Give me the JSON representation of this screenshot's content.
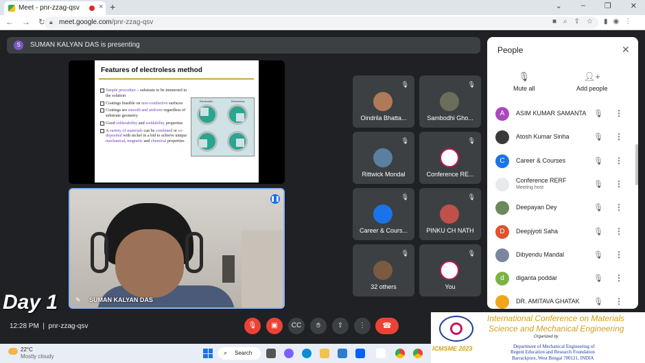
{
  "browser": {
    "tab_title": "Meet - pnr-zzag-qsv",
    "tab_close": "×",
    "new_tab": "+",
    "url_domain": "meet.google.com",
    "url_path": "/pnr-zzag-qsv",
    "window_controls": [
      "⌄",
      "–",
      "❐",
      "✕"
    ]
  },
  "presenting": {
    "avatar_letter": "S",
    "text": "SUMAN KALYAN DAS is presenting"
  },
  "slide": {
    "title": "Features of electroless method",
    "bullets": [
      {
        "parts": [
          {
            "t": "Simple procedure",
            "hl": true
          },
          {
            "t": " – substrate to be immersed in the solution",
            "hl": false
          }
        ]
      },
      {
        "parts": [
          {
            "t": "Coatings feasible on ",
            "hl": false
          },
          {
            "t": "non-conductive",
            "hl": true
          },
          {
            "t": " surfaces",
            "hl": false
          }
        ]
      },
      {
        "parts": [
          {
            "t": "Coatings are ",
            "hl": false
          },
          {
            "t": "smooth and uniform",
            "hl": true
          },
          {
            "t": " regardless of substrate geometry",
            "hl": false
          }
        ]
      },
      {
        "parts": [
          {
            "t": "Good ",
            "hl": false
          },
          {
            "t": "solderability",
            "hl": true
          },
          {
            "t": " and ",
            "hl": false
          },
          {
            "t": "weldability",
            "hl": true
          },
          {
            "t": " properties",
            "hl": false
          }
        ]
      },
      {
        "parts": [
          {
            "t": "A ",
            "hl": false
          },
          {
            "t": "variety of materials",
            "hl": true
          },
          {
            "t": " can be ",
            "hl": false
          },
          {
            "t": "combined",
            "hl": true
          },
          {
            "t": " or ",
            "hl": false
          },
          {
            "t": "co-deposited",
            "hl": true
          },
          {
            "t": " with nickel in a bid to achieve unique ",
            "hl": false
          },
          {
            "t": "mechanical",
            "hl": true
          },
          {
            "t": ", ",
            "hl": false
          },
          {
            "t": "magnetic",
            "hl": true
          },
          {
            "t": " and ",
            "hl": false
          },
          {
            "t": "chemical",
            "hl": true
          },
          {
            "t": " properties",
            "hl": false
          }
        ]
      }
    ],
    "fig_labels": [
      "Electrolytic",
      "Electroless"
    ]
  },
  "speaker": {
    "name": "SUMAN KALYAN DAS"
  },
  "overlay_label": "Day 1",
  "participants": [
    {
      "name": "Oindrila Bhatta...",
      "color": "#b07a5a"
    },
    {
      "name": "Sambodhi Gho...",
      "color": "#6b6e5a"
    },
    {
      "name": "Rittwick Mondal",
      "color": "#5a7fa0"
    },
    {
      "name": "Conference RE...",
      "color": "#ffffff"
    },
    {
      "name": "Career & Cours...",
      "color": "#1a73e8"
    },
    {
      "name": "PINKU CH NATH",
      "color": "#c0504a"
    },
    {
      "name": "32 others",
      "color": "#7a5a40"
    },
    {
      "name": "You",
      "color": "#ffffff"
    }
  ],
  "people_panel": {
    "title": "People",
    "mute_all": "Mute all",
    "add_people": "Add people",
    "list": [
      {
        "name": "ASIM KUMAR SAMANTA",
        "letter": "A",
        "color": "#ab47bc",
        "sub": ""
      },
      {
        "name": "Atosh Kumar Sinha",
        "letter": "",
        "color": "#3a3a3a",
        "sub": ""
      },
      {
        "name": "Career & Courses",
        "letter": "C",
        "color": "#1a73e8",
        "sub": ""
      },
      {
        "name": "Conference RERF",
        "letter": "",
        "color": "#e8eaed",
        "sub": "Meeting host"
      },
      {
        "name": "Deepayan Dey",
        "letter": "",
        "color": "#6a8a5a",
        "sub": ""
      },
      {
        "name": "Deepjyoti Saha",
        "letter": "D",
        "color": "#e0532c",
        "sub": ""
      },
      {
        "name": "Dibyendu Mandal",
        "letter": "",
        "color": "#7a86a0",
        "sub": ""
      },
      {
        "name": "diganta poddar",
        "letter": "d",
        "color": "#7cb342",
        "sub": ""
      },
      {
        "name": "DR. AMITAVA GHATAK",
        "letter": "",
        "color": "#f1a51a",
        "sub": ""
      }
    ]
  },
  "meeting": {
    "time": "12:28 PM",
    "code": "pnr-zzag-qsv"
  },
  "banner": {
    "line1": "International Conference on Materials",
    "line2": "Science and Mechanical Engineering",
    "organized": "Organized by",
    "year": "ICMSME 2023",
    "org1": "Department of Mechanical Engineering of",
    "org2": "Regent Education and Research Foundation",
    "org3": "Barrackpore, West Bengal 700121, INDIA"
  },
  "taskbar": {
    "temp": "22°C",
    "weather": "Mostly cloudy",
    "search": "Search"
  },
  "colors": {
    "accent": "#1a73e8",
    "end_call": "#ea4335",
    "meet_bg": "#202124"
  }
}
